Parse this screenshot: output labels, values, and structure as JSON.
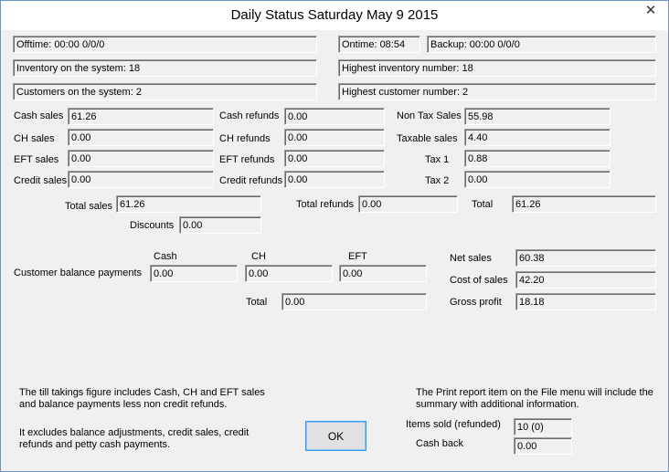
{
  "window": {
    "title": "Daily Status Saturday May 9 2015",
    "close_glyph": "✕"
  },
  "top": {
    "offtime": "Offtime: 00:00 0/0/0",
    "ontime": "Ontime: 08:54",
    "backup": "Backup: 00:00 0/0/0",
    "inventory": "Inventory on the system: 18",
    "highest_inventory": "Highest inventory number: 18",
    "customers": "Customers on the system: 2",
    "highest_customer": "Highest customer number: 2"
  },
  "sales": {
    "cash_sales_label": "Cash sales",
    "cash_sales": "61.26",
    "ch_sales_label": "CH sales",
    "ch_sales": "0.00",
    "eft_sales_label": "EFT sales",
    "eft_sales": "0.00",
    "credit_sales_label": "Credit sales",
    "credit_sales": "0.00"
  },
  "refunds": {
    "cash_refunds_label": "Cash refunds",
    "cash_refunds": "0.00",
    "ch_refunds_label": "CH refunds",
    "ch_refunds": "0.00",
    "eft_refunds_label": "EFT refunds",
    "eft_refunds": "0.00",
    "credit_refunds_label": "Credit refunds",
    "credit_refunds": "0.00"
  },
  "tax": {
    "non_tax_label": "Non Tax Sales",
    "non_tax": "55.98",
    "taxable_label": "Taxable sales",
    "taxable": "4.40",
    "tax1_label": "Tax 1",
    "tax1": "0.88",
    "tax2_label": "Tax 2",
    "tax2": "0.00"
  },
  "totals": {
    "total_sales_label": "Total sales",
    "total_sales": "61.26",
    "total_refunds_label": "Total refunds",
    "total_refunds": "0.00",
    "total_label": "Total",
    "total": "61.26",
    "discounts_label": "Discounts",
    "discounts": "0.00"
  },
  "balance": {
    "label": "Customer balance payments",
    "cash_header": "Cash",
    "cash": "0.00",
    "ch_header": "CH",
    "ch": "0.00",
    "eft_header": "EFT",
    "eft": "0.00",
    "total_label": "Total",
    "total": "0.00"
  },
  "profit": {
    "net_sales_label": "Net sales",
    "net_sales": "60.38",
    "cost_of_sales_label": "Cost of sales",
    "cost_of_sales": "42.20",
    "gross_profit_label": "Gross profit",
    "gross_profit": "18.18"
  },
  "notes": {
    "takings": "The till takings figure includes Cash, CH and EFT sales and balance payments less non credit refunds.",
    "excludes": "It excludes balance adjustments, credit sales, credit refunds and petty cash payments.",
    "print_report": "The Print report item on the File menu will include the summary with additional information."
  },
  "items": {
    "items_sold_label": "Items sold (refunded)",
    "items_sold": "10 (0)",
    "cash_back_label": "Cash back",
    "cash_back": "0.00"
  },
  "buttons": {
    "ok": "OK"
  }
}
